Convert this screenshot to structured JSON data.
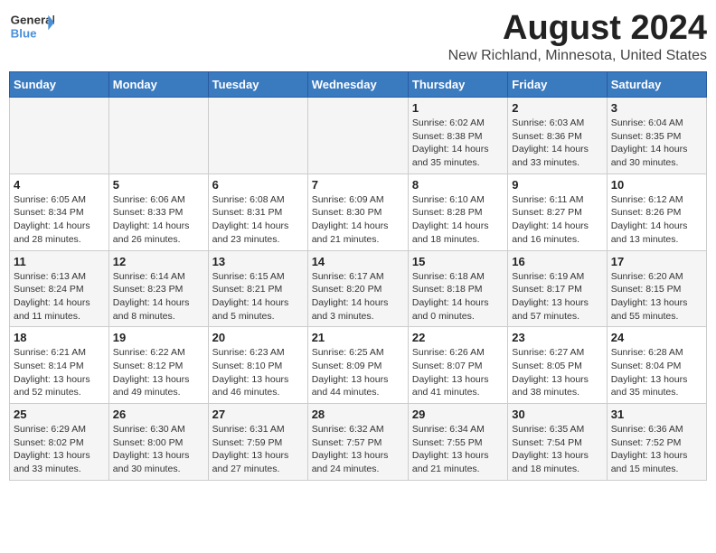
{
  "logo": {
    "line1": "General",
    "line2": "Blue"
  },
  "title": "August 2024",
  "subtitle": "New Richland, Minnesota, United States",
  "days_of_week": [
    "Sunday",
    "Monday",
    "Tuesday",
    "Wednesday",
    "Thursday",
    "Friday",
    "Saturday"
  ],
  "weeks": [
    [
      {
        "day": "",
        "info": ""
      },
      {
        "day": "",
        "info": ""
      },
      {
        "day": "",
        "info": ""
      },
      {
        "day": "",
        "info": ""
      },
      {
        "day": "1",
        "info": "Sunrise: 6:02 AM\nSunset: 8:38 PM\nDaylight: 14 hours\nand 35 minutes."
      },
      {
        "day": "2",
        "info": "Sunrise: 6:03 AM\nSunset: 8:36 PM\nDaylight: 14 hours\nand 33 minutes."
      },
      {
        "day": "3",
        "info": "Sunrise: 6:04 AM\nSunset: 8:35 PM\nDaylight: 14 hours\nand 30 minutes."
      }
    ],
    [
      {
        "day": "4",
        "info": "Sunrise: 6:05 AM\nSunset: 8:34 PM\nDaylight: 14 hours\nand 28 minutes."
      },
      {
        "day": "5",
        "info": "Sunrise: 6:06 AM\nSunset: 8:33 PM\nDaylight: 14 hours\nand 26 minutes."
      },
      {
        "day": "6",
        "info": "Sunrise: 6:08 AM\nSunset: 8:31 PM\nDaylight: 14 hours\nand 23 minutes."
      },
      {
        "day": "7",
        "info": "Sunrise: 6:09 AM\nSunset: 8:30 PM\nDaylight: 14 hours\nand 21 minutes."
      },
      {
        "day": "8",
        "info": "Sunrise: 6:10 AM\nSunset: 8:28 PM\nDaylight: 14 hours\nand 18 minutes."
      },
      {
        "day": "9",
        "info": "Sunrise: 6:11 AM\nSunset: 8:27 PM\nDaylight: 14 hours\nand 16 minutes."
      },
      {
        "day": "10",
        "info": "Sunrise: 6:12 AM\nSunset: 8:26 PM\nDaylight: 14 hours\nand 13 minutes."
      }
    ],
    [
      {
        "day": "11",
        "info": "Sunrise: 6:13 AM\nSunset: 8:24 PM\nDaylight: 14 hours\nand 11 minutes."
      },
      {
        "day": "12",
        "info": "Sunrise: 6:14 AM\nSunset: 8:23 PM\nDaylight: 14 hours\nand 8 minutes."
      },
      {
        "day": "13",
        "info": "Sunrise: 6:15 AM\nSunset: 8:21 PM\nDaylight: 14 hours\nand 5 minutes."
      },
      {
        "day": "14",
        "info": "Sunrise: 6:17 AM\nSunset: 8:20 PM\nDaylight: 14 hours\nand 3 minutes."
      },
      {
        "day": "15",
        "info": "Sunrise: 6:18 AM\nSunset: 8:18 PM\nDaylight: 14 hours\nand 0 minutes."
      },
      {
        "day": "16",
        "info": "Sunrise: 6:19 AM\nSunset: 8:17 PM\nDaylight: 13 hours\nand 57 minutes."
      },
      {
        "day": "17",
        "info": "Sunrise: 6:20 AM\nSunset: 8:15 PM\nDaylight: 13 hours\nand 55 minutes."
      }
    ],
    [
      {
        "day": "18",
        "info": "Sunrise: 6:21 AM\nSunset: 8:14 PM\nDaylight: 13 hours\nand 52 minutes."
      },
      {
        "day": "19",
        "info": "Sunrise: 6:22 AM\nSunset: 8:12 PM\nDaylight: 13 hours\nand 49 minutes."
      },
      {
        "day": "20",
        "info": "Sunrise: 6:23 AM\nSunset: 8:10 PM\nDaylight: 13 hours\nand 46 minutes."
      },
      {
        "day": "21",
        "info": "Sunrise: 6:25 AM\nSunset: 8:09 PM\nDaylight: 13 hours\nand 44 minutes."
      },
      {
        "day": "22",
        "info": "Sunrise: 6:26 AM\nSunset: 8:07 PM\nDaylight: 13 hours\nand 41 minutes."
      },
      {
        "day": "23",
        "info": "Sunrise: 6:27 AM\nSunset: 8:05 PM\nDaylight: 13 hours\nand 38 minutes."
      },
      {
        "day": "24",
        "info": "Sunrise: 6:28 AM\nSunset: 8:04 PM\nDaylight: 13 hours\nand 35 minutes."
      }
    ],
    [
      {
        "day": "25",
        "info": "Sunrise: 6:29 AM\nSunset: 8:02 PM\nDaylight: 13 hours\nand 33 minutes."
      },
      {
        "day": "26",
        "info": "Sunrise: 6:30 AM\nSunset: 8:00 PM\nDaylight: 13 hours\nand 30 minutes."
      },
      {
        "day": "27",
        "info": "Sunrise: 6:31 AM\nSunset: 7:59 PM\nDaylight: 13 hours\nand 27 minutes."
      },
      {
        "day": "28",
        "info": "Sunrise: 6:32 AM\nSunset: 7:57 PM\nDaylight: 13 hours\nand 24 minutes."
      },
      {
        "day": "29",
        "info": "Sunrise: 6:34 AM\nSunset: 7:55 PM\nDaylight: 13 hours\nand 21 minutes."
      },
      {
        "day": "30",
        "info": "Sunrise: 6:35 AM\nSunset: 7:54 PM\nDaylight: 13 hours\nand 18 minutes."
      },
      {
        "day": "31",
        "info": "Sunrise: 6:36 AM\nSunset: 7:52 PM\nDaylight: 13 hours\nand 15 minutes."
      }
    ]
  ]
}
